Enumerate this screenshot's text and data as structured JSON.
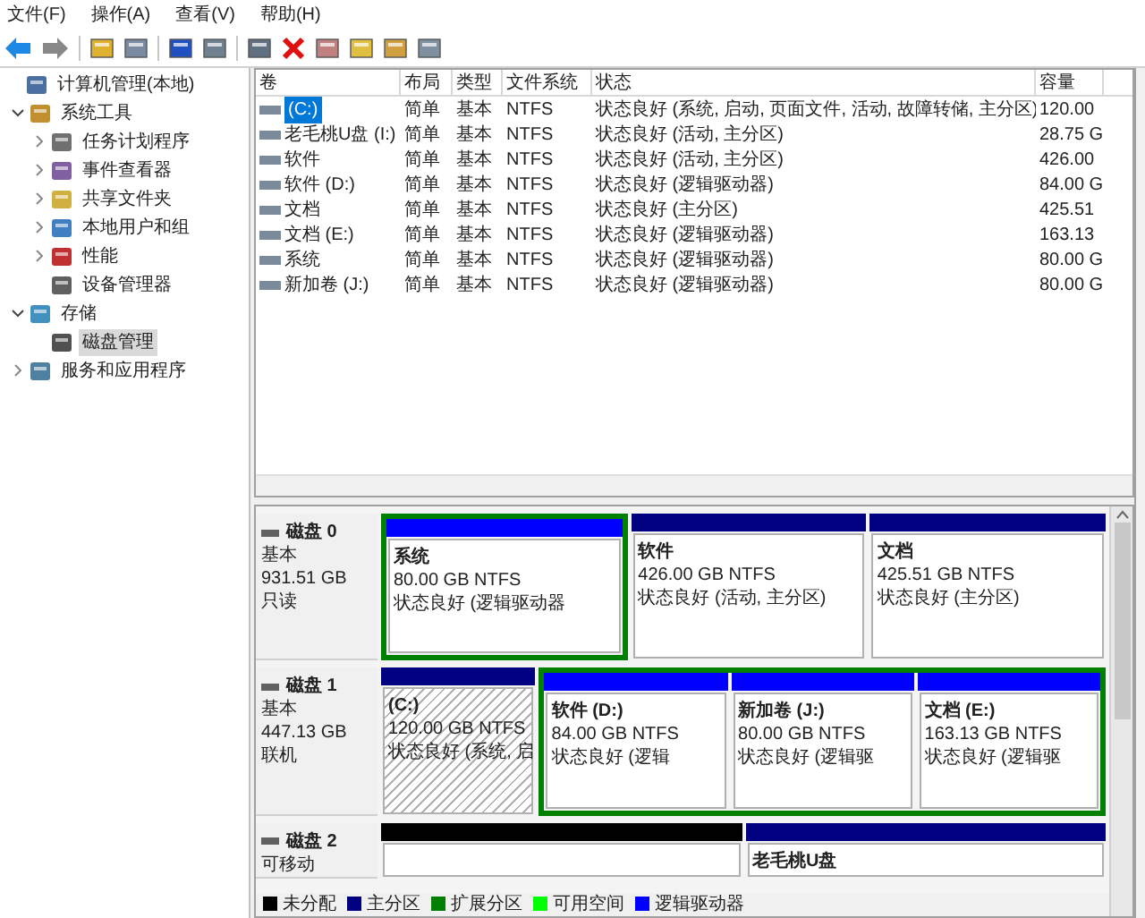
{
  "menu": [
    "文件(F)",
    "操作(A)",
    "查看(V)",
    "帮助(H)"
  ],
  "tree": [
    {
      "label": "计算机管理(本地)",
      "selected": false,
      "children": [
        {
          "label": "系统工具",
          "expanded": true,
          "selected": false,
          "children": [
            {
              "label": "任务计划程序",
              "expanded": false,
              "selected": false
            },
            {
              "label": "事件查看器",
              "expanded": false,
              "selected": false
            },
            {
              "label": "共享文件夹",
              "expanded": false,
              "selected": false
            },
            {
              "label": "本地用户和组",
              "expanded": false,
              "selected": false
            },
            {
              "label": "性能",
              "expanded": false,
              "selected": false
            },
            {
              "label": "设备管理器",
              "selected": false
            }
          ]
        },
        {
          "label": "存储",
          "expanded": true,
          "selected": false,
          "children": [
            {
              "label": "磁盘管理",
              "selected": true
            }
          ]
        },
        {
          "label": "服务和应用程序",
          "expanded": false,
          "selected": false
        }
      ]
    }
  ],
  "table": {
    "columns": [
      "卷",
      "布局",
      "类型",
      "文件系统",
      "状态",
      "容量"
    ],
    "rows": [
      {
        "cells": [
          "(C:)",
          "简单",
          "基本",
          "NTFS",
          "状态良好 (系统, 启动, 页面文件, 活动, 故障转储, 主分区)",
          "120.00"
        ],
        "selected": true
      },
      {
        "cells": [
          "老毛桃U盘 (I:)",
          "简单",
          "基本",
          "NTFS",
          "状态良好 (活动, 主分区)",
          "28.75 G"
        ],
        "selected": false
      },
      {
        "cells": [
          "软件",
          "简单",
          "基本",
          "NTFS",
          "状态良好 (活动, 主分区)",
          "426.00"
        ],
        "selected": false
      },
      {
        "cells": [
          "软件 (D:)",
          "简单",
          "基本",
          "NTFS",
          "状态良好 (逻辑驱动器)",
          "84.00 G"
        ],
        "selected": false
      },
      {
        "cells": [
          "文档",
          "简单",
          "基本",
          "NTFS",
          "状态良好 (主分区)",
          "425.51"
        ],
        "selected": false
      },
      {
        "cells": [
          "文档 (E:)",
          "简单",
          "基本",
          "NTFS",
          "状态良好 (逻辑驱动器)",
          "163.13"
        ],
        "selected": false
      },
      {
        "cells": [
          "系统",
          "简单",
          "基本",
          "NTFS",
          "状态良好 (逻辑驱动器)",
          "80.00 G"
        ],
        "selected": false
      },
      {
        "cells": [
          "新加卷 (J:)",
          "简单",
          "基本",
          "NTFS",
          "状态良好 (逻辑驱动器)",
          "80.00 G"
        ],
        "selected": false
      }
    ]
  },
  "disks": [
    {
      "name": "磁盘 0",
      "type": "基本",
      "size": "931.51 GB",
      "status": "只读",
      "partitions": [
        {
          "kind": "extended",
          "children": [
            {
              "kind": "logical",
              "selected": false,
              "lines": [
                "系统",
                "80.00 GB NTFS",
                "状态良好 (逻辑驱动器"
              ]
            }
          ]
        },
        {
          "kind": "primary",
          "selected": false,
          "lines": [
            "软件",
            "426.00 GB NTFS",
            "状态良好 (活动, 主分区)"
          ]
        },
        {
          "kind": "primary",
          "selected": false,
          "lines": [
            "文档",
            "425.51 GB NTFS",
            "状态良好 (主分区)"
          ]
        }
      ]
    },
    {
      "name": "磁盘 1",
      "type": "基本",
      "size": "447.13 GB",
      "status": "联机",
      "partitions": [
        {
          "kind": "primary",
          "selected": true,
          "lines": [
            "(C:)",
            "120.00 GB NTFS",
            "状态良好 (系统, 启"
          ]
        },
        {
          "kind": "extended",
          "children": [
            {
              "kind": "logical",
              "selected": false,
              "lines": [
                "软件  (D:)",
                "84.00 GB NTFS",
                "状态良好 (逻辑"
              ]
            },
            {
              "kind": "logical",
              "selected": false,
              "lines": [
                "新加卷  (J:)",
                "80.00 GB NTFS",
                "状态良好 (逻辑驱"
              ]
            },
            {
              "kind": "logical",
              "selected": false,
              "lines": [
                "文档  (E:)",
                "163.13 GB NTFS",
                "状态良好 (逻辑驱"
              ]
            }
          ]
        }
      ]
    },
    {
      "name": "磁盘 2",
      "type": "可移动",
      "partitions": [
        {
          "kind": "unallocated",
          "selected": false
        },
        {
          "kind": "primary",
          "selected": false,
          "lines": [
            "老毛桃U盘"
          ]
        }
      ]
    }
  ],
  "legend": [
    {
      "label": "未分配",
      "color": "#000000"
    },
    {
      "label": "主分区",
      "color": "#000080"
    },
    {
      "label": "扩展分区",
      "color": "#008000"
    },
    {
      "label": "可用空间",
      "color": "#00ff00"
    },
    {
      "label": "逻辑驱动器",
      "color": "#0000ff"
    }
  ]
}
